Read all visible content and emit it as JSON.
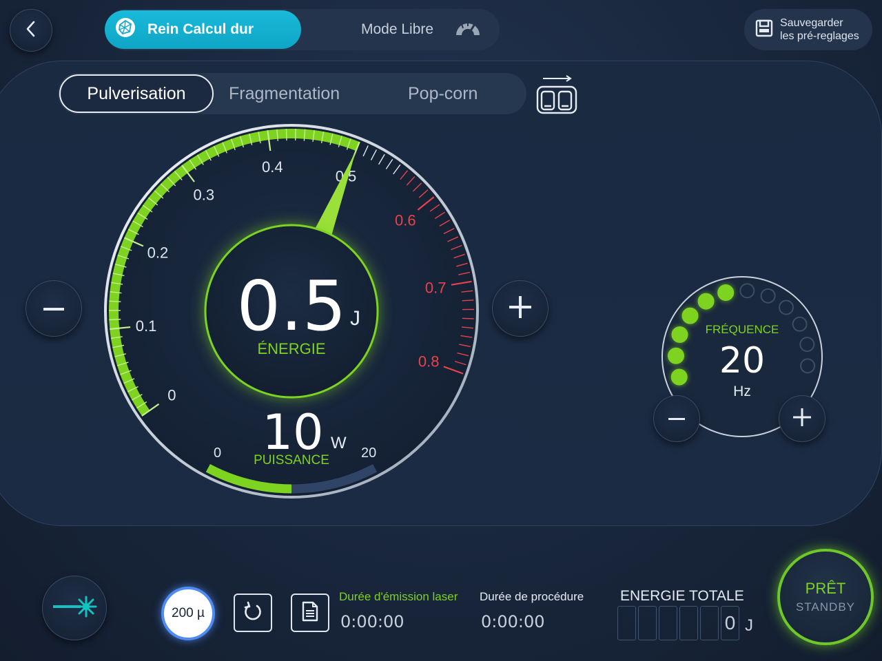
{
  "header": {
    "active_tab": "Rein Calcul dur",
    "inactive_tab": "Mode Libre",
    "save_line1": "Sauvegarder",
    "save_line2": "les pré-reglages"
  },
  "modes": [
    "Pulverisation",
    "Fragmentation",
    "Pop-corn"
  ],
  "energy_gauge": {
    "value": "0.5",
    "unit": "J",
    "label": "ÉNERGIE",
    "ticks_green": [
      "0",
      "0.1",
      "0.2",
      "0.3",
      "0.4",
      "0.5"
    ],
    "ticks_red": [
      "0.6",
      "0.7",
      "0.8"
    ],
    "level": 0.5
  },
  "power": {
    "value": "10",
    "unit": "W",
    "label": "PUISSANCE",
    "min": "0",
    "max": "20",
    "fraction": 0.5
  },
  "frequency": {
    "label": "FRÉQUENCE",
    "value": "20",
    "unit": "Hz",
    "active_dots": 6,
    "total_dots": 12
  },
  "footer": {
    "fiber": "200 µ",
    "laser_duration_label": "Durée d'émission laser",
    "laser_duration_value": "0:00:00",
    "procedure_duration_label": "Durée de procédure",
    "procedure_duration_value": "0:00:00",
    "total_energy_label": "ENERGIE TOTALE",
    "total_energy_value": "0",
    "total_energy_unit": "J",
    "ready_label": "PRÊT",
    "standby_label": "STANDBY"
  },
  "colors": {
    "accent": "#16b3d4",
    "green": "#7ed321",
    "red": "#e8434a"
  }
}
